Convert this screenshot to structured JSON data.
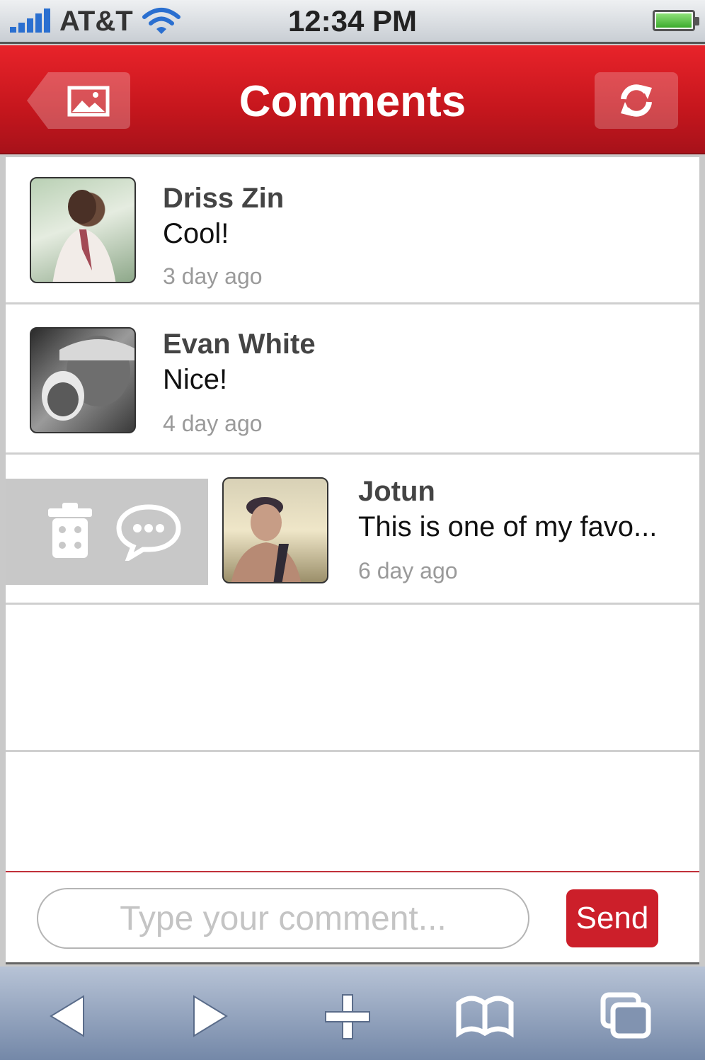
{
  "status_bar": {
    "carrier": "AT&T",
    "time": "12:34 PM",
    "icons": [
      "signal-icon",
      "wifi-icon",
      "battery-icon"
    ]
  },
  "nav": {
    "title": "Comments",
    "left_icon": "image-icon",
    "right_icon": "refresh-icon"
  },
  "comments": [
    {
      "name": "Driss Zin",
      "text": "Cool!",
      "time": "3 day ago"
    },
    {
      "name": "Evan White",
      "text": "Nice!",
      "time": "4 day ago"
    },
    {
      "name": "Jotun",
      "text": "This is one of my favo...",
      "time": "6 day ago"
    }
  ],
  "swipe_actions": [
    "trash-icon",
    "reply-bubble-icon"
  ],
  "composer": {
    "placeholder": "Type your comment...",
    "send_label": "Send"
  },
  "toolbar": {
    "icons": [
      "back-arrow-icon",
      "forward-arrow-icon",
      "add-icon",
      "bookmarks-icon",
      "tabs-icon"
    ]
  },
  "colors": {
    "accent": "#cc1f2a",
    "nav_top": "#e8232a",
    "toolbar": "#8c9cb8"
  }
}
